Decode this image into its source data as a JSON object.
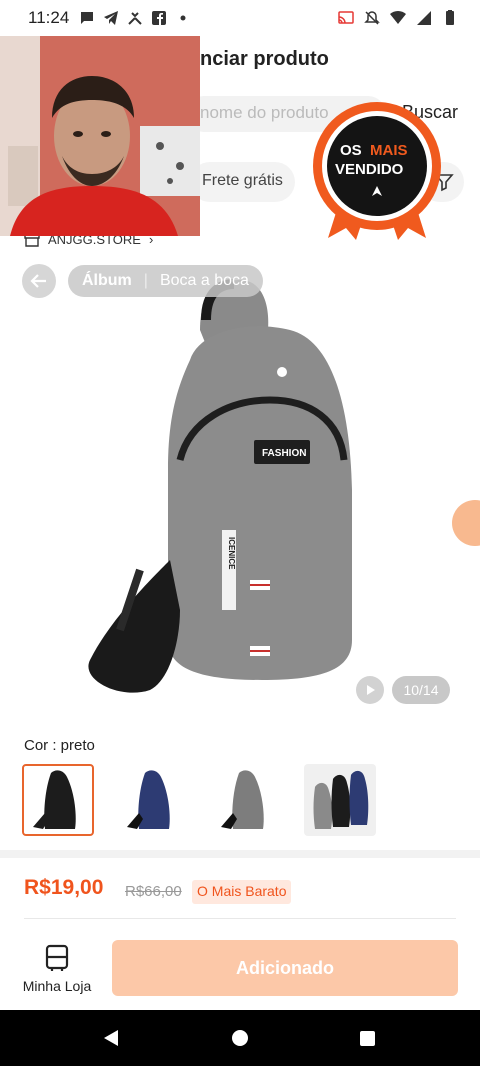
{
  "status_bar": {
    "time": "11:24",
    "left_icons": [
      "message-icon",
      "telegram-icon",
      "tools-icon",
      "facebook-icon",
      "dot-icon"
    ],
    "right_icons": [
      "cast-icon",
      "mute-icon",
      "wifi-icon",
      "signal-icon",
      "battery-icon"
    ]
  },
  "header": {
    "title": "nciar produto",
    "search_placeholder": "nome do produto",
    "search_button": "Buscar",
    "filter_chip": "Frete grátis"
  },
  "store": {
    "name": "ANJGG.STORE",
    "chevron": "›"
  },
  "badge": {
    "line1_part1": "OS",
    "line1_part2": "MAIS",
    "line2": "VENDIDO",
    "color": "#f05a1e"
  },
  "album": {
    "tabs": [
      "Álbum",
      "Boca a boca"
    ],
    "active": 0
  },
  "product_image": {
    "bag_label": "FASHION",
    "strap_text": "ICENICE"
  },
  "gallery": {
    "counter": "10/14"
  },
  "color": {
    "label": "Cor : preto",
    "swatches": [
      {
        "name": "preto",
        "color": "#1c1c1c",
        "selected": true
      },
      {
        "name": "azul",
        "color": "#2d3b73",
        "selected": false
      },
      {
        "name": "cinza",
        "color": "#7d7d7d",
        "selected": false
      },
      {
        "name": "misto",
        "color": "#555",
        "selected": false
      }
    ]
  },
  "price": {
    "current": "R$19,00",
    "original": "R$66,00",
    "tag": "O Mais Barato",
    "accent": "#f0541d"
  },
  "bottom": {
    "store_tab": "Minha Loja",
    "add_button": "Adicionado"
  }
}
